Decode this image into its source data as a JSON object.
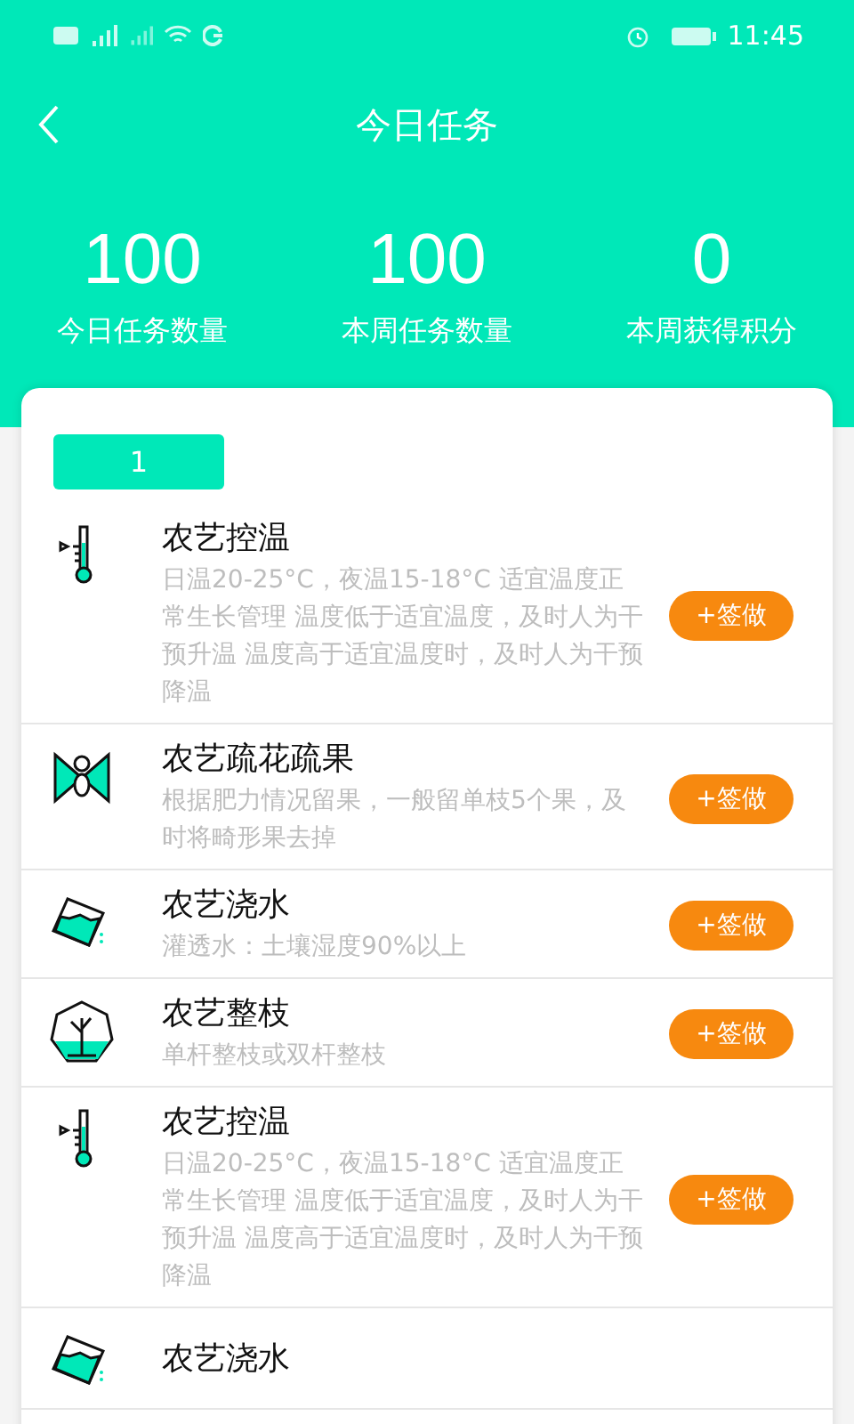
{
  "status_bar": {
    "time": "11:45"
  },
  "nav": {
    "title": "今日任务"
  },
  "stats": [
    {
      "value": "100",
      "label": "今日任务数量"
    },
    {
      "value": "100",
      "label": "本周任务数量"
    },
    {
      "value": "0",
      "label": "本周获得积分"
    }
  ],
  "tabs": [
    {
      "label": "1",
      "selected": true
    }
  ],
  "tasks": [
    {
      "kind": "temperature",
      "title": "农艺控温",
      "description": "日温20-25°C，夜温15-18°C 适宜温度正常生长管理 温度低于适宜温度，及时人为干预升温 温度高于适宜温度时，及时人为干预降温",
      "button": "+签做"
    },
    {
      "kind": "pollination",
      "title": "农艺疏花疏果",
      "description": "根据肥力情况留果，一般留单枝5个果，及时将畸形果去掉",
      "button": "+签做"
    },
    {
      "kind": "watering",
      "title": "农艺浇水",
      "description": "灌透水：土壤湿度90%以上",
      "button": "+签做"
    },
    {
      "kind": "pruning",
      "title": "农艺整枝",
      "description": "单杆整枝或双杆整枝",
      "button": "+签做"
    },
    {
      "kind": "temperature",
      "title": "农艺控温",
      "description": "日温20-25°C，夜温15-18°C 适宜温度正常生长管理 温度低于适宜温度，及时人为干预升温 温度高于适宜温度时，及时人为干预降温",
      "button": "+签做"
    },
    {
      "kind": "watering",
      "title": "农艺浇水"
    }
  ]
}
